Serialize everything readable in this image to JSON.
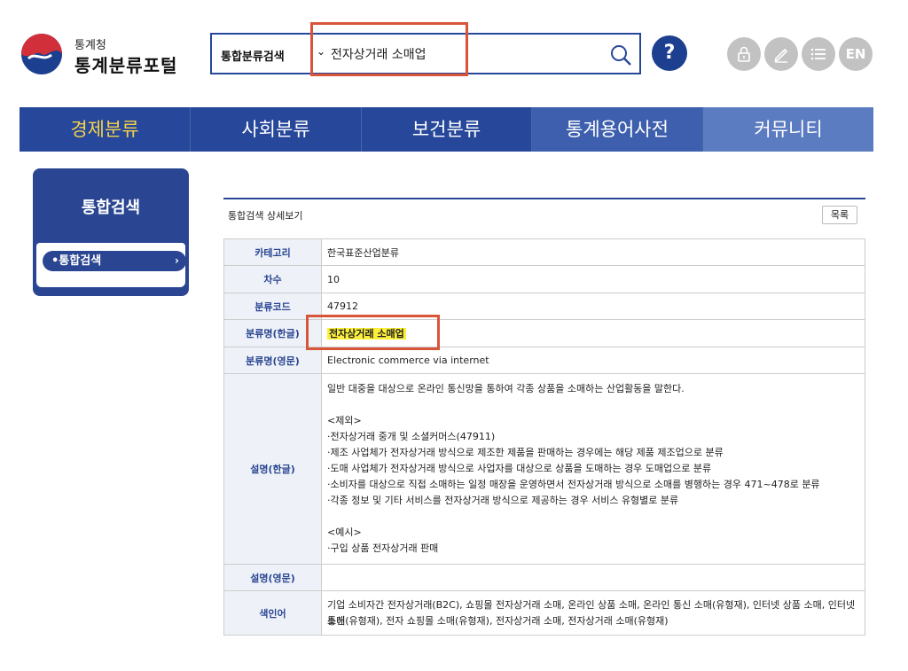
{
  "header": {
    "logo_small": "통계청",
    "logo_big": "통계분류포털",
    "search_category": "통합분류검색",
    "search_value": "전자상거래 소매업",
    "help_label": "?",
    "lang_label": "EN"
  },
  "nav": {
    "items": [
      {
        "label": "경제분류"
      },
      {
        "label": "사회분류"
      },
      {
        "label": "보건분류"
      },
      {
        "label": "통계용어사전"
      },
      {
        "label": "커뮤니티"
      }
    ]
  },
  "sidebar": {
    "title": "통합검색",
    "item_label": "•통합검색",
    "item_chevron": "›"
  },
  "content": {
    "title": "통합검색 상세보기",
    "list_button": "목록",
    "rows": [
      {
        "label": "카테고리",
        "value": "한국표준산업분류"
      },
      {
        "label": "차수",
        "value": "10"
      },
      {
        "label": "분류코드",
        "value": "47912"
      },
      {
        "label": "분류명(한글)",
        "value": "전자상거래 소매업"
      },
      {
        "label": "분류명(영문)",
        "value": "Electronic commerce via internet"
      },
      {
        "label": "설명(한글)",
        "lines": [
          "일반 대중을 대상으로 온라인 통신망을 통하여 각종 상품을 소매하는 산업활동을 말한다.",
          "",
          "<제외>",
          "·전자상거래 중개 및 소셜커머스(47911)",
          "·제조 사업체가 전자상거래 방식으로 제조한 제품을 판매하는 경우에는 해당 제품 제조업으로 분류",
          "·도매 사업체가 전자상거래 방식으로 사업자를 대상으로 상품을 도매하는 경우 도매업으로 분류",
          "·소비자를 대상으로 직접 소매하는 일정 매장을 운영하면서 전자상거래 방식으로 소매를 병행하는 경우 471~478로 분류",
          "·각종 정보 및 기타 서비스를 전자상거래 방식으로 제공하는 경우 서비스 유형별로 분류",
          "",
          "<예시>",
          "·구입 상품 전자상거래 판매"
        ]
      },
      {
        "label": "설명(영문)",
        "value": ""
      },
      {
        "label": "색인어",
        "lines": [
          "기업 소비자간 전자상거래(B2C), 쇼핑몰 전자상거래 소매, 온라인 상품 소매, 온라인 통신 소매(유형재), 인터넷 상품 소매, 인터넷 통신",
          "소매(유형재), 전자 쇼핑몰 소매(유형재), 전자상거래 소매, 전자상거래 소매(유형재)"
        ]
      }
    ]
  },
  "colors": {
    "primary": "#2a4592",
    "nav_active_text": "#f5d24a",
    "highlight": "#fbef3a",
    "annotation_red": "#d8553a"
  }
}
